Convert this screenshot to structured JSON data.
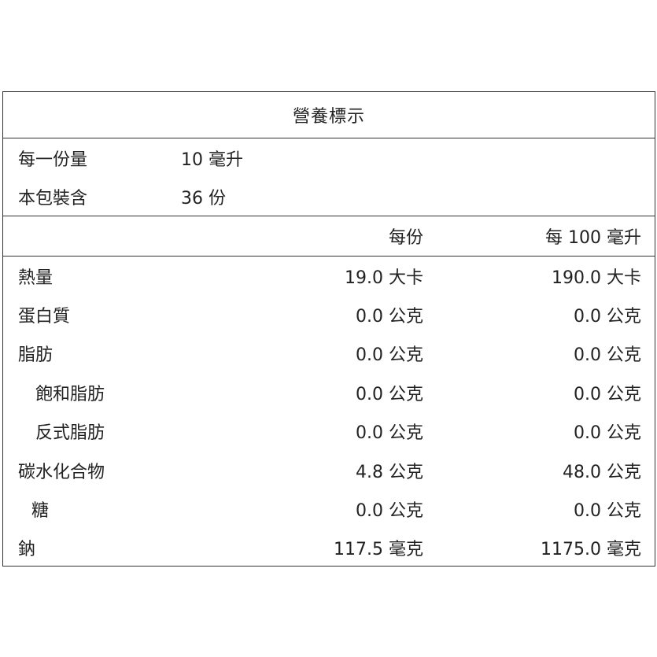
{
  "title": "營養標示",
  "serving": {
    "size_label": "每一份量",
    "size_value": "10 毫升",
    "count_label": "本包裝含",
    "count_value": "36 份"
  },
  "columns": {
    "per_serving": "每份",
    "per_100": "每 100 毫升"
  },
  "nutrients": [
    {
      "name": "熱量",
      "per_serving": "19.0 大卡",
      "per_100": "190.0 大卡"
    },
    {
      "name": "蛋白質",
      "per_serving": "0.0 公克",
      "per_100": "0.0 公克"
    },
    {
      "name": "脂肪",
      "per_serving": "0.0 公克",
      "per_100": "0.0 公克"
    },
    {
      "name": "飽和脂肪",
      "per_serving": "0.0 公克",
      "per_100": "0.0 公克"
    },
    {
      "name": "反式脂肪",
      "per_serving": "0.0 公克",
      "per_100": "0.0 公克"
    },
    {
      "name": "碳水化合物",
      "per_serving": "4.8 公克",
      "per_100": "48.0 公克"
    },
    {
      "name": "糖",
      "per_serving": "0.0 公克",
      "per_100": "0.0 公克"
    },
    {
      "name": "鈉",
      "per_serving": "117.5 毫克",
      "per_100": "1175.0 毫克"
    }
  ]
}
